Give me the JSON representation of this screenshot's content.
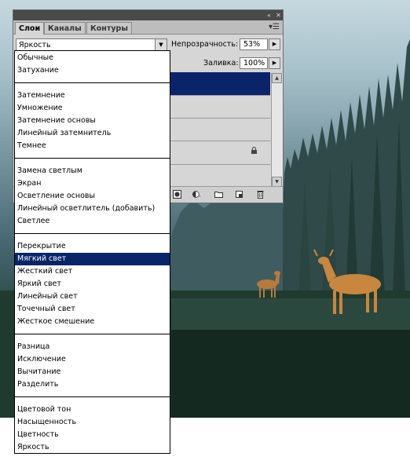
{
  "panel": {
    "tabs": [
      "Слои",
      "Каналы",
      "Контуры"
    ],
    "blend_mode_value": "Яркость",
    "opacity_label": "Непрозрачность:",
    "opacity_value": "53%",
    "fill_label": "Заливка:",
    "fill_value": "100%"
  },
  "dropdown": {
    "groups": [
      [
        "Обычные",
        "Затухание"
      ],
      [
        "Затемнение",
        "Умножение",
        "Затемнение основы",
        "Линейный затемнитель",
        "Темнее"
      ],
      [
        "Замена светлым",
        "Экран",
        "Осветление основы",
        "Линейный осветлитель (добавить)",
        "Светлее"
      ],
      [
        "Перекрытие",
        "Мягкий свет",
        "Жесткий свет",
        "Яркий свет",
        "Линейный свет",
        "Точечный свет",
        "Жесткое смешение"
      ],
      [
        "Разница",
        "Исключение",
        "Вычитание",
        "Разделить"
      ],
      [
        "Цветовой тон",
        "Насыщенность",
        "Цветность",
        "Яркость"
      ]
    ],
    "selected": "Мягкий свет"
  },
  "colors": {
    "selection": "#0a246a",
    "panel_bg": "#d6d6d6"
  }
}
